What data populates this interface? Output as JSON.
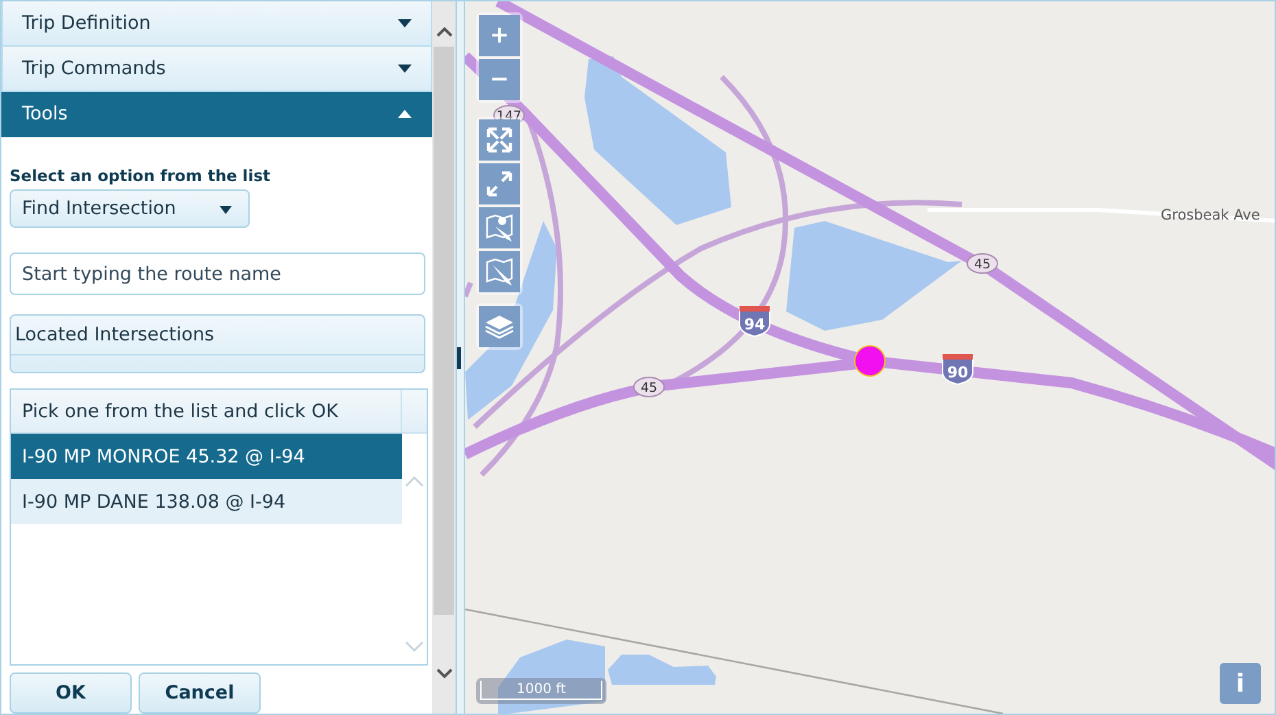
{
  "accordion": [
    {
      "label": "Trip Definition",
      "expanded": false
    },
    {
      "label": "Trip Commands",
      "expanded": false
    },
    {
      "label": "Tools",
      "expanded": true
    }
  ],
  "tools": {
    "option_label": "Select an option from the list",
    "option_dropdown": "Find Intersection",
    "route_field": {
      "placeholder": "Start typing the route name"
    },
    "located_header": "Located Intersections",
    "list_header": "Pick one from the list and click OK",
    "results": [
      {
        "label": "I-90 MP MONROE 45.32 @ I-94",
        "selected": true
      },
      {
        "label": "I-90 MP DANE 138.08 @ I-94",
        "selected": false
      }
    ],
    "buttons": [
      "OK",
      "Cancel"
    ]
  },
  "map": {
    "zoom_in": "+",
    "zoom_out": "−",
    "route_shields": [
      {
        "text": "147",
        "kind": "state"
      },
      {
        "text": "94",
        "kind": "interstate"
      },
      {
        "text": "45",
        "kind": "state"
      },
      {
        "text": "45",
        "kind": "state"
      },
      {
        "text": "90",
        "kind": "interstate"
      }
    ],
    "street_label": "Grosbeak Ave",
    "scale": "1000 ft",
    "info": "i"
  }
}
